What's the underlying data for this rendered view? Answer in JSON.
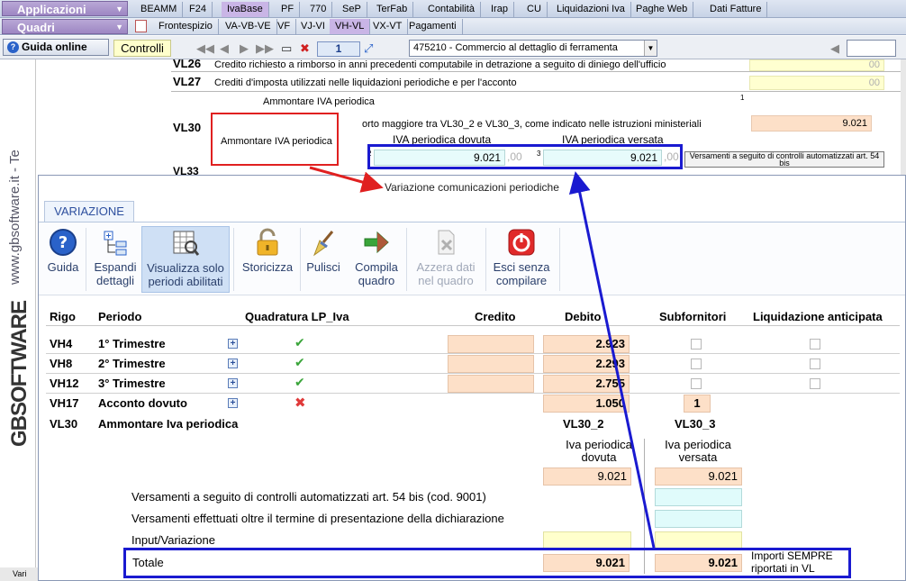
{
  "menu": {
    "applicazioni_label": "Applicazioni",
    "quadri_label": "Quadri",
    "tabs_row1": [
      "BEAMM",
      "F24",
      "IvaBase",
      "PF",
      "770",
      "SeP",
      "TerFab",
      "Contabilità",
      "Irap",
      "CU",
      "Liquidazioni Iva",
      "Paghe Web",
      "Dati Fatture"
    ],
    "tabs_row2": [
      "Frontespizio",
      "VA-VB-VE",
      "VF",
      "VJ-VI",
      "VH-VL",
      "VX-VT",
      "Pagamenti"
    ]
  },
  "toolbar": {
    "guida_label": "Guida online",
    "controlli_label": "Controlli",
    "page_number": "1",
    "activity_combo": "475210 - Commercio al dettaglio di ferramenta"
  },
  "brand": {
    "site": "www.gbsoftware.it - Te",
    "logo_text": "GBSOFTWARE"
  },
  "bg_form": {
    "vl26_code": "VL26",
    "vl26_text": "Credito richiesto a rimborso in anni precedenti computabile in detrazione a seguito di diniego dell'ufficio",
    "vl26_value": "00",
    "vl27_code": "VL27",
    "vl27_text": "Crediti d'imposta utilizzati nelle liquidazioni periodiche e per l'acconto",
    "vl27_value": "00",
    "ammontare_heading": "Ammontare IVA periodica",
    "vl30_code": "VL30",
    "vl30_field1_num": "1",
    "vl30_text": "orto maggiore tra VL30_2 e VL30_3, come indicato nelle istruzioni ministeriali",
    "vl30_value1": "9.021",
    "red_label": "Ammontare IVA periodica",
    "iva_dovuta_label": "IVA periodica dovuta",
    "iva_versata_label": "IVA periodica versata",
    "field2_num": "2",
    "field3_num": "3",
    "iva_dovuta_value": "9.021",
    "iva_versata_value": "9.021",
    "cents": ",00",
    "versamenti_btn": "Versamenti a seguito di controlli automatizzati art. 54 bis",
    "vl33_code": "VL33"
  },
  "dialog": {
    "title": "Variazione comunicazioni periodiche",
    "tab": "VARIAZIONE",
    "ribbon": [
      {
        "label": "Guida"
      },
      {
        "label": "Espandi dettagli"
      },
      {
        "label": "Visualizza solo periodi abilitati"
      },
      {
        "label": "Storicizza"
      },
      {
        "label": "Pulisci"
      },
      {
        "label": "Compila quadro"
      },
      {
        "label": "Azzera dati nel quadro"
      },
      {
        "label": "Esci senza compilare"
      }
    ],
    "headers": {
      "rigo": "Rigo",
      "periodo": "Periodo",
      "quadratura": "Quadratura LP_Iva",
      "credito": "Credito",
      "debito": "Debito",
      "subfornitori": "Subfornitori",
      "liquidazione": "Liquidazione anticipata"
    },
    "rows": [
      {
        "rigo": "VH4",
        "periodo": "1° Trimestre",
        "debito": "2.923"
      },
      {
        "rigo": "VH8",
        "periodo": "2° Trimestre",
        "debito": "2.293"
      },
      {
        "rigo": "VH12",
        "periodo": "3° Trimestre",
        "debito": "2.755"
      },
      {
        "rigo": "VH17",
        "periodo": "Acconto dovuto",
        "debito": "1.050",
        "subfornitori": "1"
      }
    ],
    "vl30_row": {
      "rigo": "VL30",
      "periodo": "Ammontare Iva periodica",
      "col2": "VL30_2",
      "col3": "VL30_3",
      "col2_sub1": "Iva periodica",
      "col2_sub2": "dovuta",
      "col3_sub1": "Iva periodica",
      "col3_sub2": "versata",
      "col2_value": "9.021",
      "col3_value": "9.021"
    },
    "versamenti_54bis": "Versamenti a seguito di controlli automatizzati art. 54 bis (cod. 9001)",
    "versamenti_oltre": "Versamenti effettuati oltre il termine di presentazione della dichiarazione",
    "input_variazione": "Input/Variazione",
    "totale_label": "Totale",
    "totale_col2": "9.021",
    "totale_col3": "9.021",
    "note_line1": "Importi SEMPRE",
    "note_line2": "riportati in VL"
  },
  "statusbar": {
    "text": "Vari"
  },
  "colors": {
    "accent_blue": "#1a1ad0",
    "highlight_red": "#e02020",
    "peach": "#fde0c8",
    "menu_purple": "#9d87c3"
  }
}
